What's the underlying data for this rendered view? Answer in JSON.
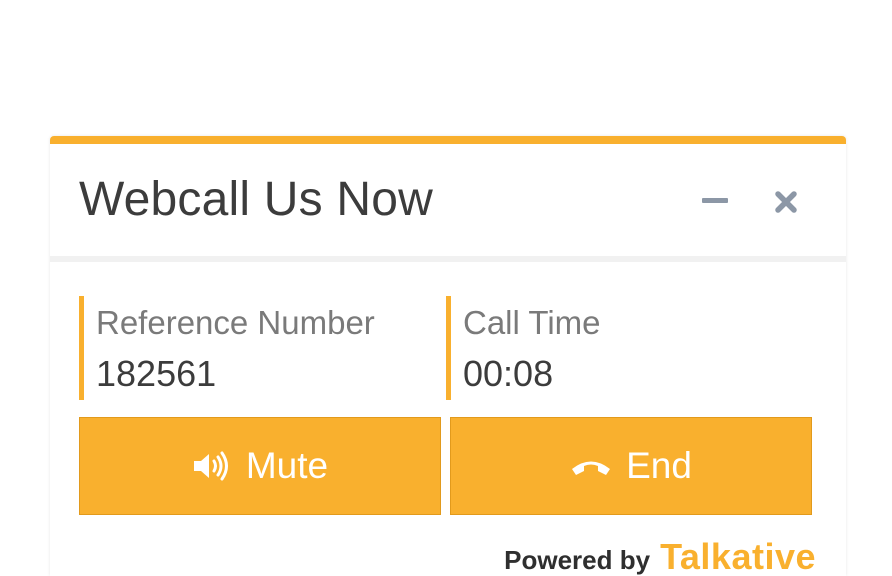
{
  "widget": {
    "title": "Webcall Us Now",
    "accent_color": "#f9b02e",
    "header_icons": {
      "minimize": "minimize-icon",
      "close": "close-icon"
    }
  },
  "info": {
    "reference_label": "Reference Number",
    "reference_value": "182561",
    "call_time_label": "Call Time",
    "call_time_value": "00:08"
  },
  "buttons": {
    "mute_label": "Mute",
    "mute_icon": "speaker-icon",
    "end_label": "End",
    "end_icon": "hang-up-phone-icon"
  },
  "footer": {
    "powered_by": "Powered by",
    "brand": "Talkative"
  }
}
